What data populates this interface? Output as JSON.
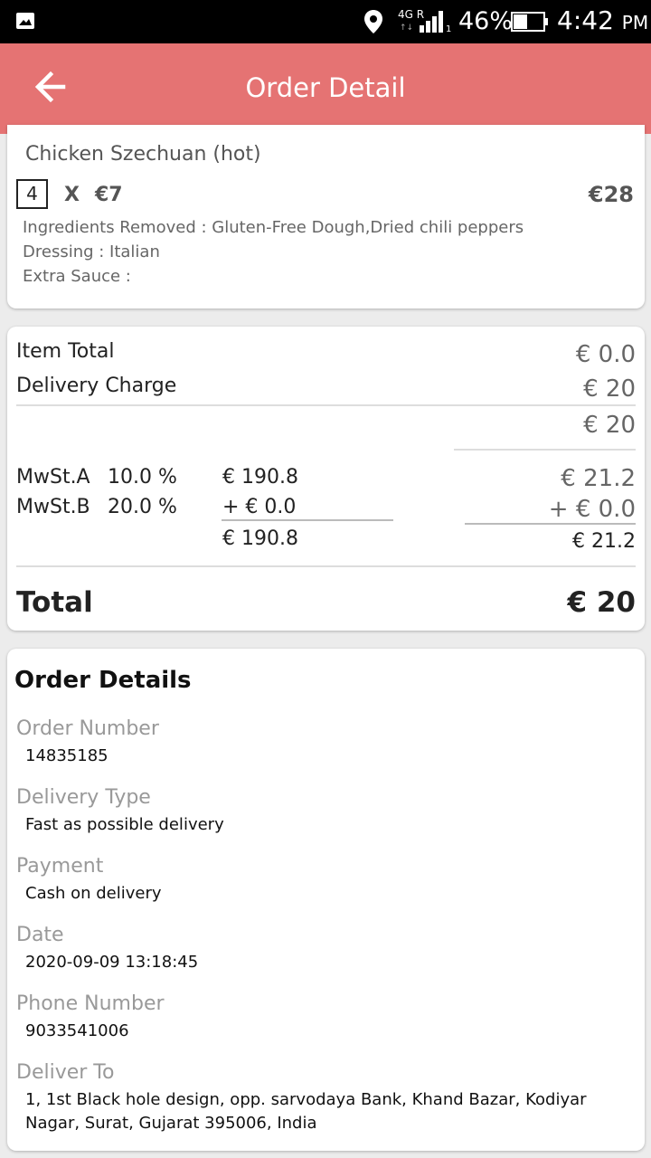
{
  "status_bar": {
    "network": "4G R",
    "network_sub": "1",
    "battery_pct": "46%",
    "time": "4:42",
    "ampm": "PM"
  },
  "app_bar": {
    "title": "Order Detail",
    "back_icon": "arrow-back-icon"
  },
  "item": {
    "name": "Chicken Szechuan (hot)",
    "quantity": "4",
    "times": "X",
    "unit_price": "€7",
    "line_price": "€28",
    "ingredients_removed": "Ingredients Removed : Gluten-Free Dough,Dried chili peppers",
    "dressing": "Dressing : Italian",
    "extra_sauce": "Extra Sauce :"
  },
  "summary": {
    "item_total_label": "Item Total",
    "item_total_value": "€ 0.0",
    "delivery_charge_label": "Delivery Charge",
    "delivery_charge_value": "€ 20",
    "subtotal_value": "€ 20",
    "taxes": [
      {
        "name": "MwSt.A",
        "rate": "10.0 %",
        "base": "€ 190.8",
        "amount": "€ 21.2"
      },
      {
        "name": "MwSt.B",
        "rate": "20.0 %",
        "base": "+ € 0.0",
        "amount": "+ € 0.0"
      }
    ],
    "tax_base_total": "€ 190.8",
    "tax_amount_total": "€ 21.2",
    "total_label": "Total",
    "total_value": "€ 20"
  },
  "order_details": {
    "title": "Order Details",
    "order_number_label": "Order Number",
    "order_number": "14835185",
    "delivery_type_label": "Delivery Type",
    "delivery_type": "Fast as possible delivery",
    "payment_label": "Payment",
    "payment": "Cash on delivery",
    "date_label": "Date",
    "date": "2020-09-09 13:18:45",
    "phone_label": "Phone Number",
    "phone": "9033541006",
    "deliver_to_label": "Deliver To",
    "deliver_to": "1, 1st Black hole design, opp. sarvodaya Bank, Khand Bazar, Kodiyar Nagar, Surat, Gujarat 395006, India"
  },
  "colors": {
    "app_bar": "#e57373",
    "status_bar": "#000000",
    "background": "#ececec"
  }
}
